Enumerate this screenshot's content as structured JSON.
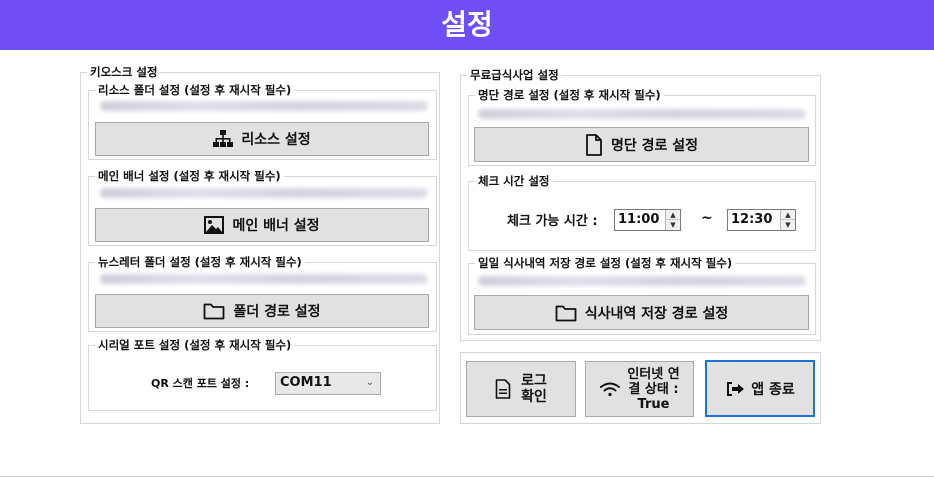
{
  "header": {
    "title": "설정"
  },
  "kiosk": {
    "title": "키오스크 설정",
    "resource": {
      "title": "리소스 폴더 설정 (설정 후 재시작 필수)",
      "button": "리소스 설정",
      "icon": "sitemap-icon"
    },
    "banner": {
      "title": "메인 배너 설정 (설정 후 재시작 필수)",
      "button": "메인 배너 설정",
      "icon": "image-icon"
    },
    "newsletter": {
      "title": "뉴스레터 폴더 설정 (설정 후 재시작 필수)",
      "button": "폴더 경로 설정",
      "icon": "folder-icon"
    },
    "serial": {
      "title": "시리얼 포트 설정 (설정 후 재시작 필수)",
      "qr_label": "QR 스캔 포트 설정 :",
      "port_value": "COM11"
    }
  },
  "meal": {
    "title": "무료급식사업 설정",
    "roster": {
      "title": "명단 경로 설정 (설정 후 재시작 필수)",
      "button": "명단 경로 설정",
      "icon": "file-icon"
    },
    "check_time": {
      "title": "체크 시간 설정",
      "label": "체크 가능 시간 :",
      "start": "11:00",
      "separator": "~",
      "end": "12:30"
    },
    "history": {
      "title": "일일 식사내역 저장 경로 설정 (설정 후 재시작 필수)",
      "button": "식사내역 저장 경로 설정",
      "icon": "folder-icon"
    }
  },
  "actions": {
    "log": {
      "line1": "로그",
      "line2": "확인",
      "icon": "document-icon"
    },
    "network": {
      "line1": "인터넷 연",
      "line2": "결 상태 :",
      "line3": "True",
      "icon": "wifi-icon"
    },
    "exit": {
      "label": "앱 종료",
      "icon": "sign-out-icon"
    }
  },
  "colors": {
    "header": "#6f4ef6",
    "button_bg": "#e1e1e1",
    "focus_border": "#1a73d9"
  }
}
